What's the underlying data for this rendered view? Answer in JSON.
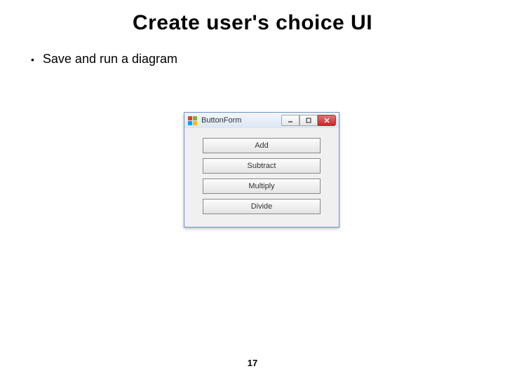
{
  "title": "Create user's choice UI",
  "bullets": [
    "Save and run a diagram"
  ],
  "window": {
    "title": "ButtonForm",
    "buttons": [
      "Add",
      "Subtract",
      "Multiply",
      "Divide"
    ]
  },
  "page": "17"
}
